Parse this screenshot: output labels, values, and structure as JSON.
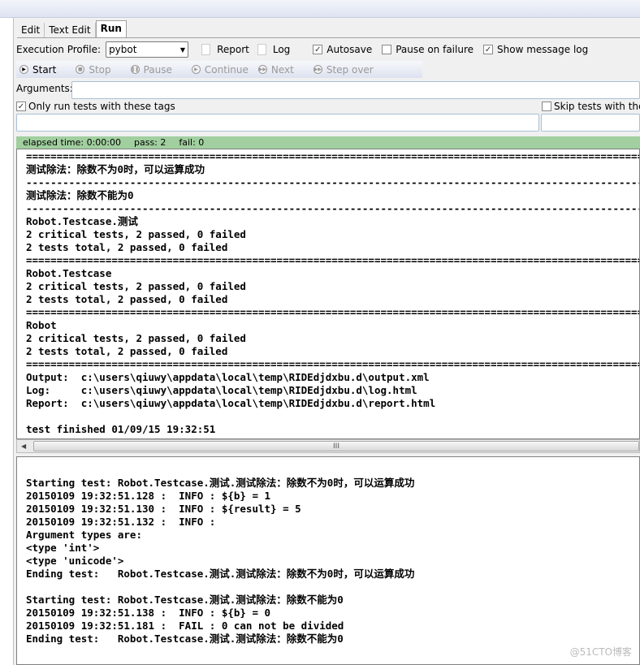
{
  "tabs": [
    {
      "label": "Edit"
    },
    {
      "label": "Text Edit"
    },
    {
      "label": "Run",
      "active": true
    }
  ],
  "toolbar": {
    "profile_label": "Execution Profile:",
    "profile_value": "pybot",
    "report": "Report",
    "log": "Log",
    "autosave": {
      "label": "Autosave",
      "checked": true
    },
    "pause_on_failure": {
      "label": "Pause on failure",
      "checked": false
    },
    "show_message_log": {
      "label": "Show message log",
      "checked": true
    }
  },
  "run_buttons": [
    {
      "label": "Start",
      "enabled": true
    },
    {
      "label": "Stop",
      "enabled": false
    },
    {
      "label": "Pause",
      "enabled": false
    },
    {
      "label": "Continue",
      "enabled": false
    },
    {
      "label": "Next",
      "enabled": false
    },
    {
      "label": "Step over",
      "enabled": false
    }
  ],
  "arguments": {
    "label": "Arguments:",
    "value": ""
  },
  "tags": {
    "only_run": {
      "label": "Only run tests with these tags",
      "checked": true,
      "value": ""
    },
    "skip": {
      "label": "Skip tests with thes",
      "checked": false,
      "value": ""
    }
  },
  "status": {
    "elapsed": "elapsed time: 0:00:00",
    "pass": "pass: 2",
    "fail": "fail: 0",
    "color": "#a1cf9f"
  },
  "output_lines": [
    "==============================================================================================================",
    "测试除法：除数不为0时，可以运算成功",
    "--------------------------------------------------------------------------------------------------------------",
    "测试除法：除数不能为0",
    "--------------------------------------------------------------------------------------------------------------",
    "Robot.Testcase.测试",
    "2 critical tests, 2 passed, 0 failed",
    "2 tests total, 2 passed, 0 failed",
    "==============================================================================================================",
    "Robot.Testcase",
    "2 critical tests, 2 passed, 0 failed",
    "2 tests total, 2 passed, 0 failed",
    "==============================================================================================================",
    "Robot",
    "2 critical tests, 2 passed, 0 failed",
    "2 tests total, 2 passed, 0 failed",
    "==============================================================================================================",
    "Output:  c:\\users\\qiuwy\\appdata\\local\\temp\\RIDEdjdxbu.d\\output.xml",
    "Log:     c:\\users\\qiuwy\\appdata\\local\\temp\\RIDEdjdxbu.d\\log.html",
    "Report:  c:\\users\\qiuwy\\appdata\\local\\temp\\RIDEdjdxbu.d\\report.html",
    "",
    "test finished 01/09/15 19:32:51"
  ],
  "scrollbar_grip": "III",
  "message_lines": [
    "",
    "Starting test: Robot.Testcase.测试.测试除法：除数不为0时，可以运算成功",
    "20150109 19:32:51.128 :  INFO : ${b} = 1",
    "20150109 19:32:51.130 :  INFO : ${result} = 5",
    "20150109 19:32:51.132 :  INFO : ",
    "Argument types are:",
    "<type 'int'>",
    "<type 'unicode'>",
    "Ending test:   Robot.Testcase.测试.测试除法：除数不为0时，可以运算成功",
    "",
    "Starting test: Robot.Testcase.测试.测试除法：除数不能为0",
    "20150109 19:32:51.138 :  INFO : ${b} = 0",
    "20150109 19:32:51.181 :  FAIL : 0 can not be divided",
    "Ending test:   Robot.Testcase.测试.测试除法：除数不能为0"
  ],
  "watermark": "@51CTO博客"
}
